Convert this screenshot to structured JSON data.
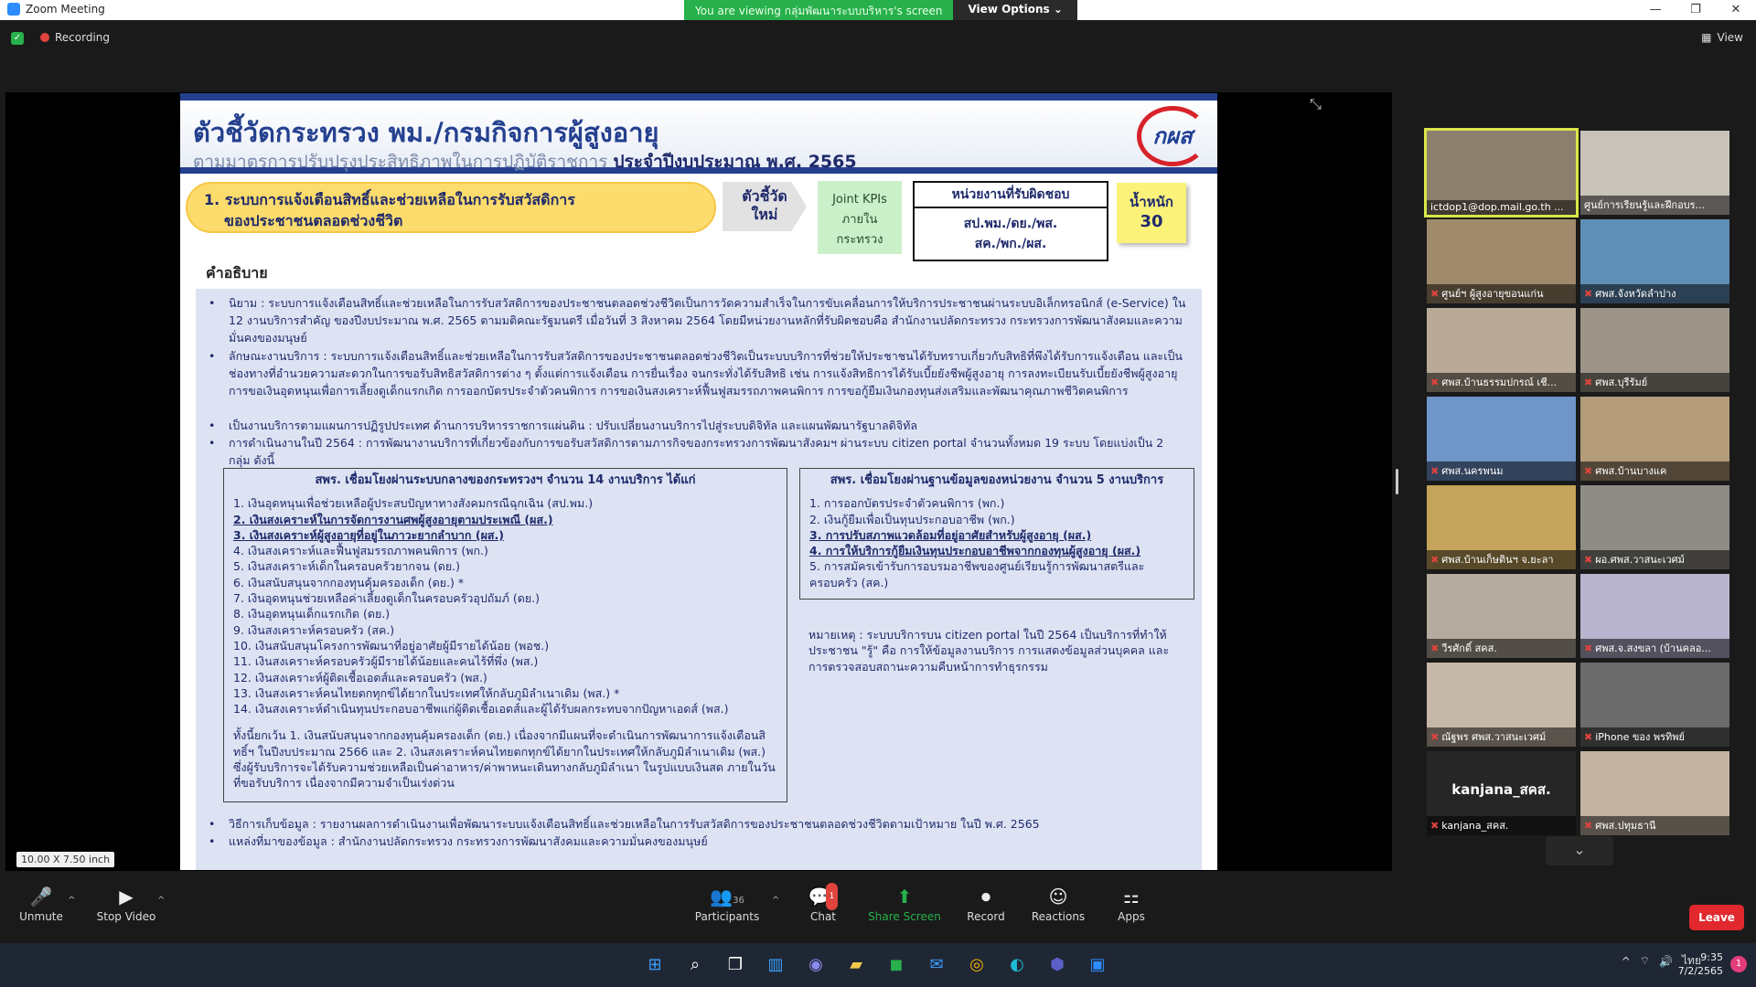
{
  "window": {
    "title": "Zoom Meeting",
    "minimize": "—",
    "restore": "❐",
    "close": "✕"
  },
  "banner": {
    "message": "You are viewing กลุ่มพัฒนาระบบบริหาร's screen",
    "options": "View Options ⌄"
  },
  "status": {
    "recording": "Recording",
    "view": "View"
  },
  "slide": {
    "title": "ตัวชี้วัดกระทรวง พม./กรมกิจการผู้สูงอายุ",
    "subtitle_prefix": "ตามมาตรการปรับปรุงประสิทธิภาพในการปฏิบัติราชการ",
    "subtitle_bold": "ประจำปีงบประมาณ พ.ศ. 2565",
    "logo": "กผส",
    "indicator_line1": "1. ระบบการแจ้งเตือนสิทธิ์และช่วยเหลือในการรับสวัสดิการ",
    "indicator_line2": "ของประชาชนตลอดช่วงชีวิต",
    "new_kpi_line1": "ตัวชี้วัด",
    "new_kpi_line2": "ใหม่",
    "joint_line1": "Joint KPIs",
    "joint_line2": "ภายใน",
    "joint_line3": "กระทรวง",
    "owner_title": "หน่วยงานที่รับผิดชอบ",
    "owner_line1": "สป.พม./ดย./พส.",
    "owner_line2": "สค./พก./ผส.",
    "weight_label": "น้ำหนัก",
    "weight_value": "30",
    "explain": "คำอธิบาย",
    "b1": "นิยาม : ระบบการแจ้งเตือนสิทธิ์และช่วยเหลือในการรับสวัสดิการของประชาชนตลอดช่วงชีวิตเป็นการวัดความสำเร็จในการขับเคลื่อนการให้บริการประชาชนผ่านระบบอิเล็กทรอนิกส์ (e-Service) ใน 12 งานบริการสำคัญ ของปีงบประมาณ พ.ศ. 2565 ตามมติคณะรัฐมนตรี เมื่อวันที่ 3 สิงหาคม 2564 โดยมีหน่วยงานหลักที่รับผิดชอบคือ สำนักงานปลัดกระทรวง กระทรวงการพัฒนาสังคมและความมั่นคงของมนุษย์",
    "b2": "ลักษณะงานบริการ : ระบบการแจ้งเตือนสิทธิ์และช่วยเหลือในการรับสวัสดิการของประชาชนตลอดช่วงชีวิตเป็นระบบบริการที่ช่วยให้ประชาชนได้รับทราบเกี่ยวกับสิทธิที่พึงได้รับการแจ้งเตือน และเป็นช่องทางที่อำนวยความสะดวกในการขอรับสิทธิสวัสดิการต่าง ๆ ตั้งแต่การแจ้งเตือน การยื่นเรื่อง จนกระทั่งได้รับสิทธิ เช่น การแจ้งสิทธิการได้รับเบี้ยยังชีพผู้สูงอายุ การลงทะเบียนรับเบี้ยยังชีพผู้สูงอายุ การขอเงินอุดหนุนเพื่อการเลี้ยงดูเด็กแรกเกิด การออกบัตรประจำตัวคนพิการ การขอเงินสงเคราะห์ฟื้นฟูสมรรถภาพคนพิการ การขอกู้ยืมเงินกองทุนส่งเสริมและพัฒนาคุณภาพชีวิตคนพิการ",
    "b3": "เป็นงานบริการตามแผนการปฏิรูปประเทศ ด้านการบริหารราชการแผ่นดิน : ปรับเปลี่ยนงานบริการไปสู่ระบบดิจิทัล และแผนพัฒนารัฐบาลดิจิทัล",
    "b4": "การดำเนินงานในปี 2564 : การพัฒนางานบริการที่เกี่ยวข้องกับการขอรับสวัสดิการตามภารกิจของกระทรวงการพัฒนาสังคมฯ ผ่านระบบ citizen portal จำนวนทั้งหมด 19 ระบบ โดยแบ่งเป็น 2 กลุ่ม ดังนี้",
    "left_head": "สพร. เชื่อมโยงผ่านระบบกลางของกระทรวงฯ จำนวน 14 งานบริการ ได้แก่",
    "left_items": [
      "1. เงินอุดหนุนเพื่อช่วยเหลือผู้ประสบปัญหาทางสังคมกรณีฉุกเฉิน (สป.พม.)",
      "2. เงินสงเคราะห์ในการจัดการงานศพผู้สูงอายุตามประเพณี (ผส.)",
      "3. เงินสงเคราะห์ผู้สูงอายุที่อยู่ในภาวะยากลำบาก (ผส.)",
      "4. เงินสงเคราะห์และฟื้นฟูสมรรถภาพคนพิการ (พก.)",
      "5. เงินสงเคราะห์เด็กในครอบครัวยากจน (ดย.)",
      "6. เงินสนับสนุนจากกองทุนคุ้มครองเด็ก (ดย.) *",
      "7. เงินอุดหนุนช่วยเหลือค่าเลี้ยงดูเด็กในครอบครัวอุปถัมภ์ (ดย.)",
      "8. เงินอุดหนุนเด็กแรกเกิด (ดย.)",
      "9. เงินสงเคราะห์ครอบครัว (สค.)",
      "10. เงินสนับสนุนโครงการพัฒนาที่อยู่อาศัยผู้มีรายได้น้อย (พอช.)",
      "11. เงินสงเคราะห์ครอบครัวผู้มีรายได้น้อยและคนไร้ที่พึ่ง (พส.)",
      "12. เงินสงเคราะห์ผู้ติดเชื้อเอดส์และครอบครัว (พส.)",
      "13. เงินสงเคราะห์คนไทยตกทุกข์ได้ยากในประเทศให้กลับภูมิลำเนาเดิม (พส.) *",
      "14. เงินสงเคราะห์ดำเนินทุนประกอบอาชีพแก่ผู้ติดเชื้อเอดส์และผู้ได้รับผลกระทบจากปัญหาเอดส์ (พส.)"
    ],
    "left_note": "ทั้งนี้ยกเว้น 1. เงินสนับสนุนจากกองทุนคุ้มครองเด็ก (ดย.) เนื่องจากมีแผนที่จะดำเนินการพัฒนาการแจ้งเตือนสิทธิ์ฯ ในปีงบประมาณ 2566 และ 2. เงินสงเคราะห์คนไทยตกทุกข์ได้ยากในประเทศให้กลับภูมิลำเนาเดิม (พส.) ซึ่งผู้รับบริการจะได้รับความช่วยเหลือเป็นค่าอาหาร/ค่าพาหนะเดินทางกลับภูมิลำเนา ในรูปแบบเงินสด ภายในวันที่ขอรับบริการ เนื่องจากมีความจำเป็นเร่งด่วน",
    "right_head": "สพร. เชื่อมโยงผ่านฐานข้อมูลของหน่วยงาน จำนวน 5 งานบริการ",
    "right_items": [
      "1. การออกบัตรประจำตัวคนพิการ (พก.)",
      "2. เงินกู้ยืมเพื่อเป็นทุนประกอบอาชีพ (พก.)",
      "3. การปรับสภาพแวดล้อมที่อยู่อาศัยสำหรับผู้สูงอายุ (ผส.)",
      "4. การให้บริการกู้ยืมเงินทุนประกอบอาชีพจากกองทุนผู้สูงอายุ (ผส.)",
      "5. การสมัครเข้ารับการอบรมอาชีพของศูนย์เรียนรู้การพัฒนาสตรีและครอบครัว (สค.)"
    ],
    "remark": "หมายเหตุ : ระบบบริการบน citizen portal ในปี 2564 เป็นบริการที่ทำให้ประชาชน \"รู้\" คือ การให้ข้อมูลงานบริการ การแสดงข้อมูลส่วนบุคคล และการตรวจสอบสถานะความคืบหน้าการทำธุรกรรม",
    "b5": "วิธีการเก็บข้อมูล : รายงานผลการดำเนินงานเพื่อพัฒนาระบบแจ้งเตือนสิทธิ์และช่วยเหลือในการรับสวัสดิการของประชาชนตลอดช่วงชีวิตตามเป้าหมาย ในปี พ.ศ. 2565",
    "b6": "แหล่งที่มาของข้อมูล : สำนักงานปลัดกระทรวง กระทรวงการพัฒนาสังคมและความมั่นคงของมนุษย์"
  },
  "size_badge": "10.00 X 7.50 inch",
  "participants": [
    {
      "name": "ictdop1@dop.mail.go.th ...",
      "muted": false,
      "bg": "#8d7f6e"
    },
    {
      "name": "ศูนย์การเรียนรู้และฝึกอบร...",
      "muted": false,
      "bg": "#c9c2ba"
    },
    {
      "name": "ศูนย์ฯ ผู้สูงอายุขอนแก่น",
      "muted": true,
      "bg": "#a08a6c"
    },
    {
      "name": "ศพส.จังหวัดลำปาง",
      "muted": true,
      "bg": "#5f8fb5"
    },
    {
      "name": "ศพส.บ้านธรรมปกรณ์ เชี...",
      "muted": true,
      "bg": "#b8aa96"
    },
    {
      "name": "ศพส.บุรีรัมย์",
      "muted": true,
      "bg": "#9c9488"
    },
    {
      "name": "ศพส.นครพนม",
      "muted": true,
      "bg": "#6f95c9"
    },
    {
      "name": "ศพส.บ้านบางแค",
      "muted": true,
      "bg": "#b49b7a"
    },
    {
      "name": "ศพส.บ้านเก็ษตินฯ จ.ยะลา",
      "muted": true,
      "bg": "#c4a35a"
    },
    {
      "name": "ผอ.ศพส.วาสนะเวศม์",
      "muted": true,
      "bg": "#8f8c86"
    },
    {
      "name": "วีรศักดิ์ สคส.",
      "muted": true,
      "bg": "#b5ab9e"
    },
    {
      "name": "ศพส.จ.สงขลา (บ้านคลอ...",
      "muted": true,
      "bg": "#b9b4ce"
    },
    {
      "name": "ณัฐพร ศพส.วาสนะเวศม์",
      "muted": true,
      "bg": "#c6b8a8"
    },
    {
      "name": "iPhone ของ พรทิพย์",
      "muted": true,
      "bg": "#6b6b6b"
    },
    {
      "name": "kanjana_สคส.",
      "muted": true,
      "bg": "#262626",
      "label": "kanjana_สคส."
    },
    {
      "name": "ศพส.ปทุมธานี",
      "muted": true,
      "bg": "#c2b3a2"
    }
  ],
  "toolbar": {
    "unmute": "Unmute",
    "stop_video": "Stop Video",
    "participants": "Participants",
    "participants_count": "36",
    "chat": "Chat",
    "chat_badge": "1",
    "share": "Share Screen",
    "record": "Record",
    "reactions": "Reactions",
    "apps": "Apps",
    "leave": "Leave"
  },
  "taskbar": {
    "lang": "ไทย",
    "time": "9:35",
    "date": "7/2/2565",
    "notifications": "1"
  },
  "colors": {
    "accent": "#2d8cff",
    "green": "#27b04b",
    "danger": "#e0282e"
  }
}
